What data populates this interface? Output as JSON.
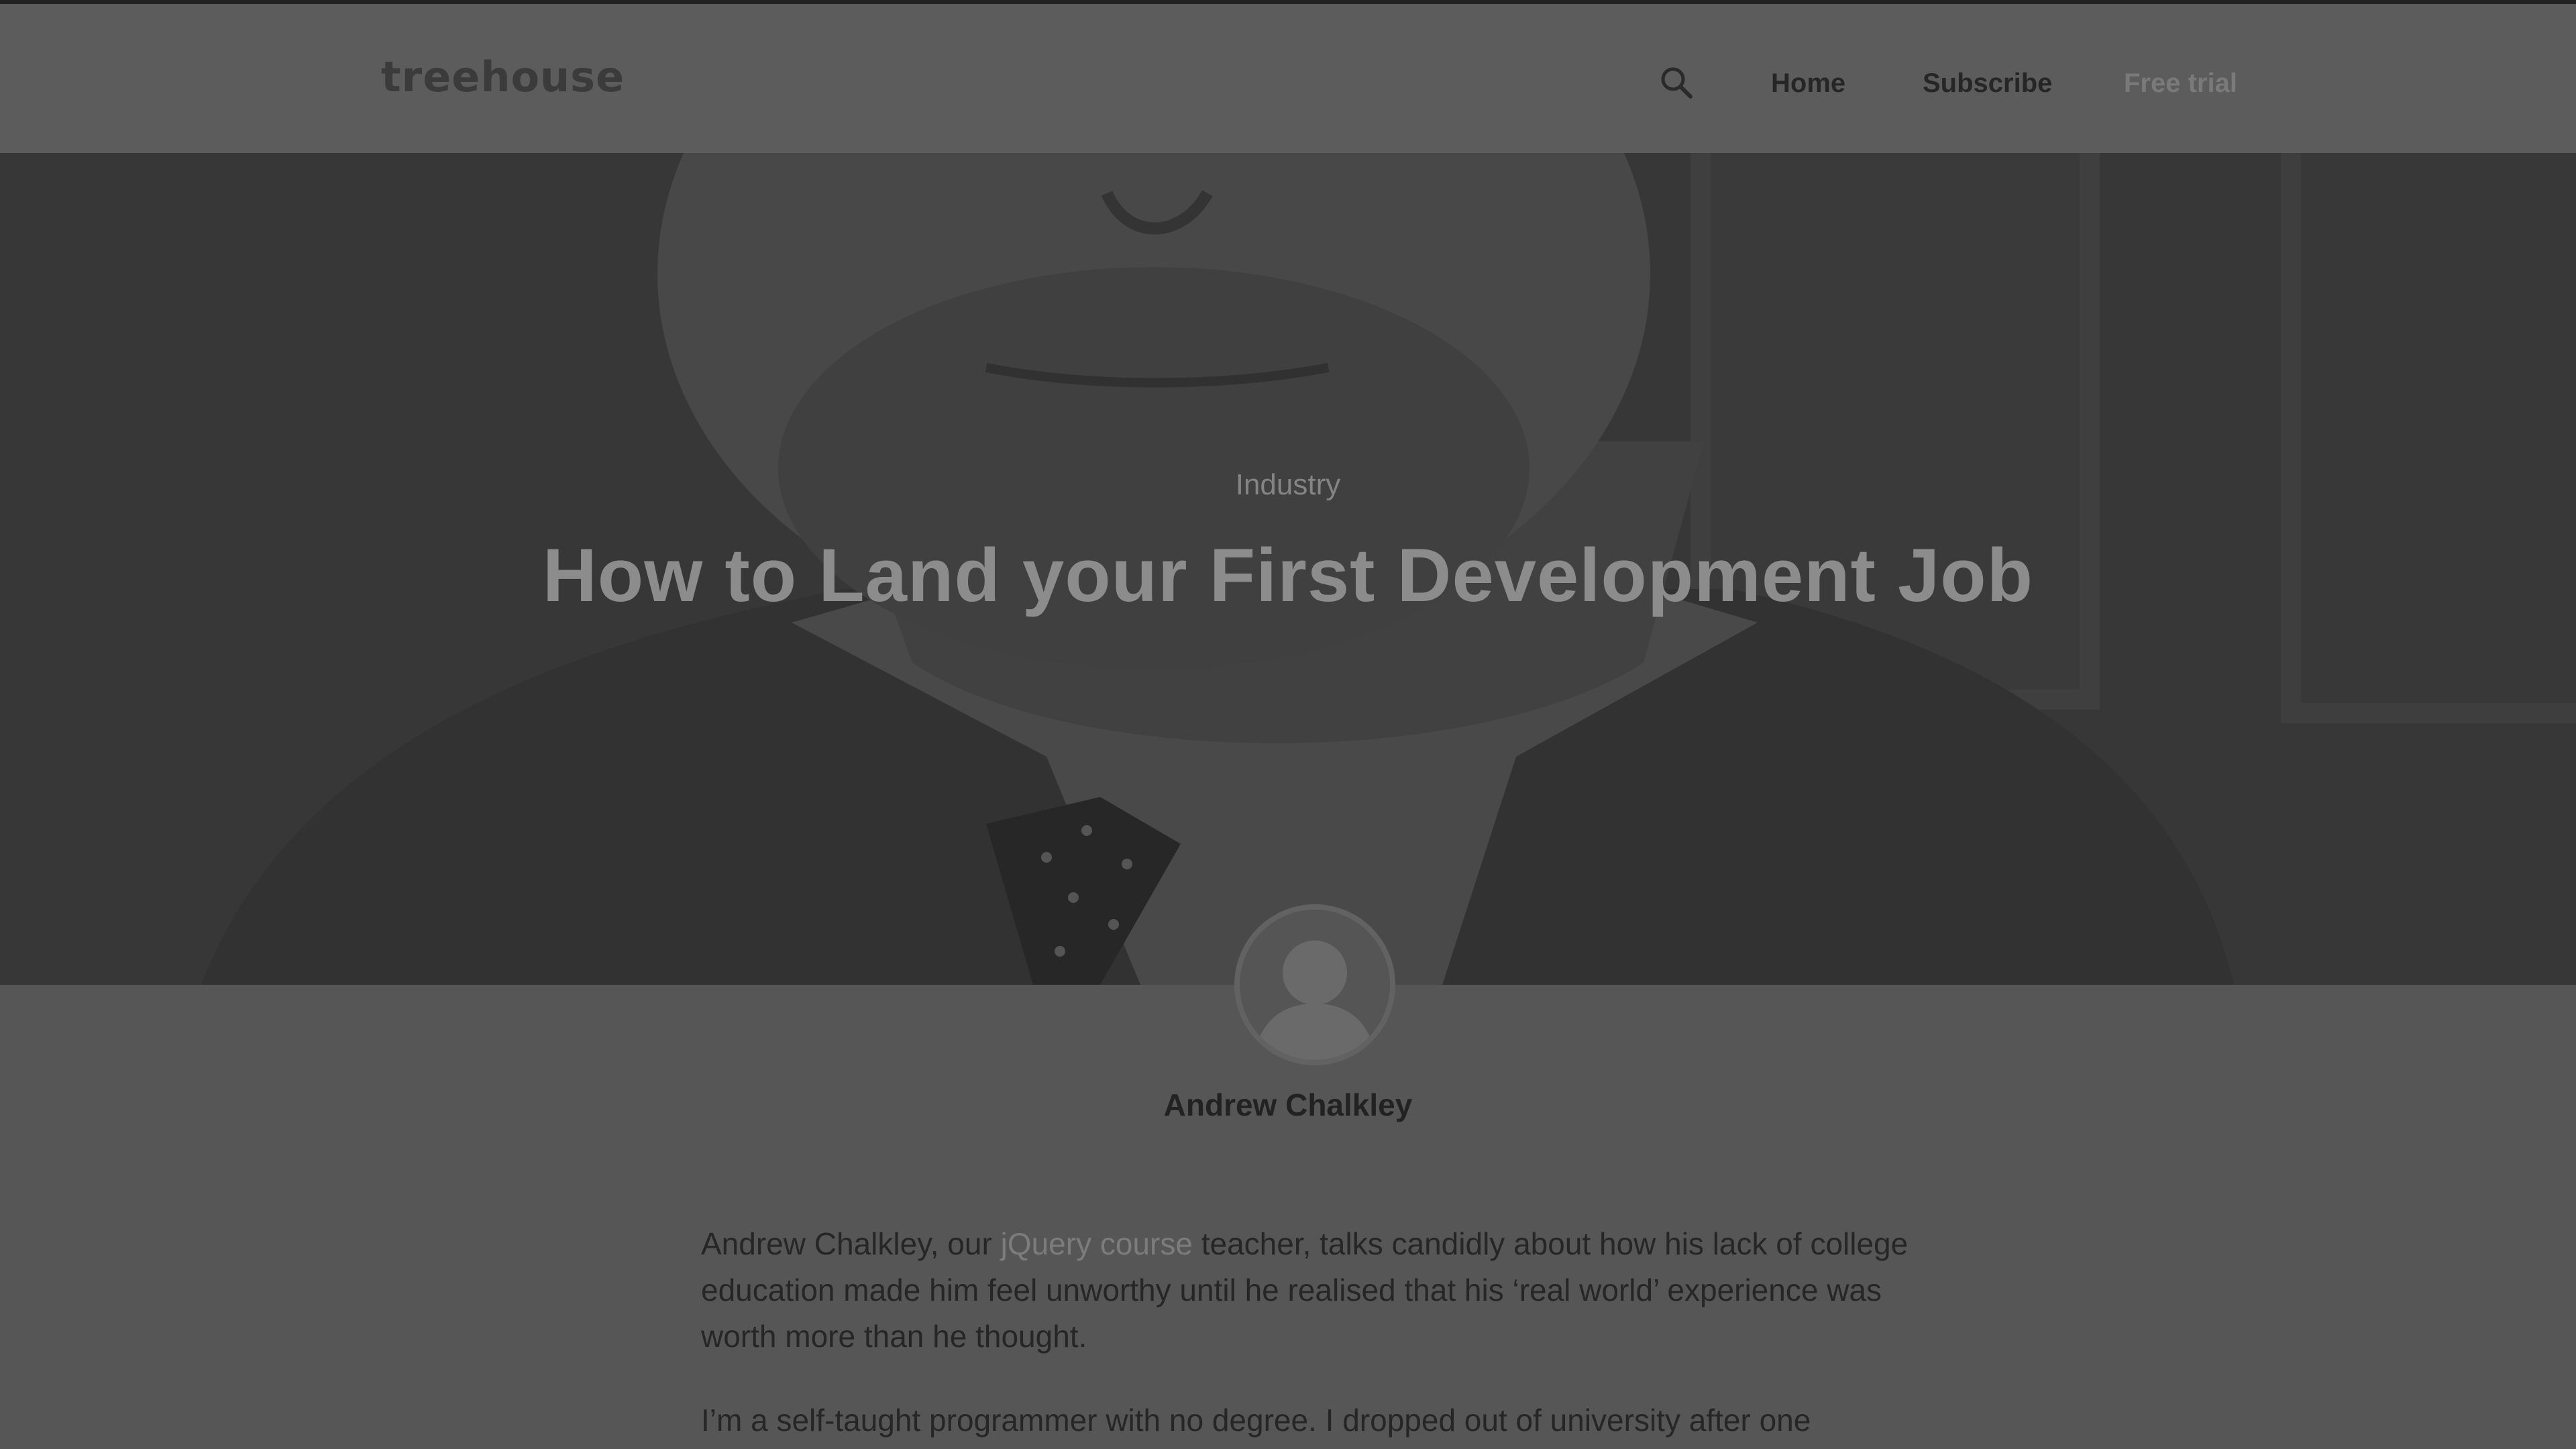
{
  "header": {
    "logo": "treehouse",
    "search_icon": "search-icon",
    "nav": {
      "home": "Home",
      "subscribe": "Subscribe",
      "free_trial": "Free trial"
    }
  },
  "hero": {
    "category": "Industry",
    "title": "How to Land your First Development Job"
  },
  "author": {
    "avatar_icon": "user-avatar-icon",
    "name": "Andrew Chalkley"
  },
  "article": {
    "p1_before_link": "Andrew Chalkley, our ",
    "p1_link": "jQuery course",
    "p1_after_link": " teacher, talks candidly about how his lack of college education made him feel unworthy until he realised that his ‘real world’ experience was worth more than he thought.",
    "p2": "I’m a self-taught programmer with no degree. I dropped out of university after one"
  },
  "colors": {
    "overlay": "#565656",
    "hero_bg": "#3f3f3f",
    "link": "#7c7c7c"
  }
}
